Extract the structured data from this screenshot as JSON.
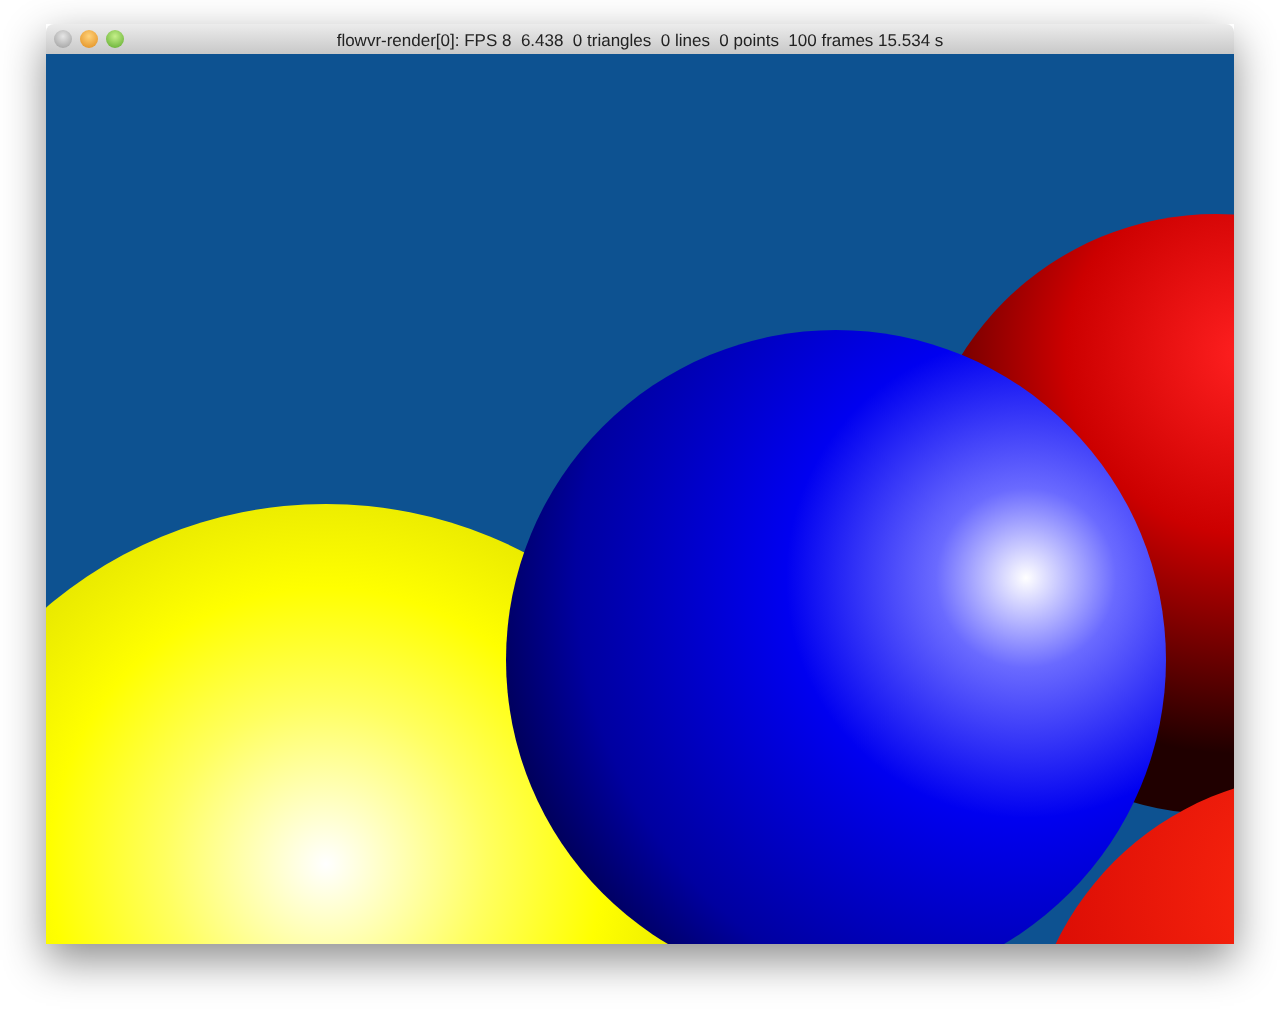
{
  "window": {
    "title": "flowvr-render[0]: FPS 8  6.438  0 triangles  0 lines  0 points  100 frames 15.534 s"
  }
}
